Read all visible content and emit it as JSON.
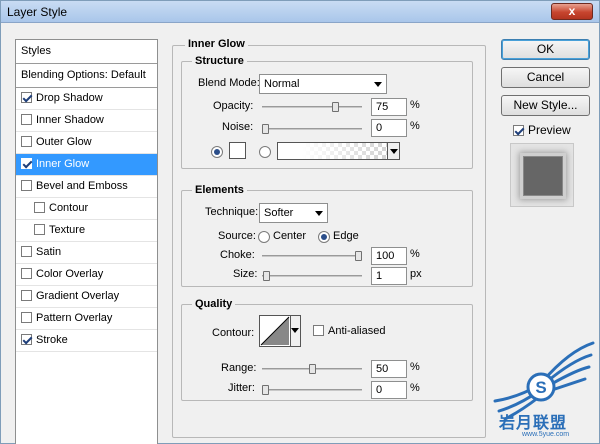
{
  "window": {
    "title": "Layer Style",
    "close_glyph": "x"
  },
  "styles_list": {
    "header": "Styles",
    "blending": "Blending Options: Default",
    "items": [
      {
        "label": "Drop Shadow",
        "checked": true
      },
      {
        "label": "Inner Shadow",
        "checked": false
      },
      {
        "label": "Outer Glow",
        "checked": false
      },
      {
        "label": "Inner Glow",
        "checked": true,
        "selected": true
      },
      {
        "label": "Bevel and Emboss",
        "checked": false
      },
      {
        "label": "Contour",
        "checked": false,
        "sub": true
      },
      {
        "label": "Texture",
        "checked": false,
        "sub": true
      },
      {
        "label": "Satin",
        "checked": false
      },
      {
        "label": "Color Overlay",
        "checked": false
      },
      {
        "label": "Gradient Overlay",
        "checked": false
      },
      {
        "label": "Pattern Overlay",
        "checked": false
      },
      {
        "label": "Stroke",
        "checked": true
      }
    ]
  },
  "panel": {
    "title": "Inner Glow",
    "structure": {
      "legend": "Structure",
      "blend_mode_label": "Blend Mode:",
      "blend_mode_value": "Normal",
      "opacity_label": "Opacity:",
      "opacity_value": "75",
      "opacity_level": 75,
      "opacity_unit": "%",
      "noise_label": "Noise:",
      "noise_value": "0",
      "noise_level": 0,
      "noise_unit": "%",
      "color_selected": true,
      "swatch_color": "#ffffff"
    },
    "elements": {
      "legend": "Elements",
      "technique_label": "Technique:",
      "technique_value": "Softer",
      "source_label": "Source:",
      "source_center": "Center",
      "source_edge": "Edge",
      "source_selected": "Edge",
      "choke_label": "Choke:",
      "choke_value": "100",
      "choke_level": 100,
      "choke_unit": "%",
      "size_label": "Size:",
      "size_value": "1",
      "size_level": 1,
      "size_unit": "px"
    },
    "quality": {
      "legend": "Quality",
      "contour_label": "Contour:",
      "anti_aliased_label": "Anti-aliased",
      "anti_aliased": false,
      "range_label": "Range:",
      "range_value": "50",
      "range_level": 50,
      "range_unit": "%",
      "jitter_label": "Jitter:",
      "jitter_value": "0",
      "jitter_level": 0,
      "jitter_unit": "%"
    }
  },
  "buttons": {
    "ok": "OK",
    "cancel": "Cancel",
    "new_style": "New Style..."
  },
  "preview": {
    "label": "Preview",
    "checked": true
  },
  "watermark": {
    "text": "岩月联盟",
    "sub": "www.5yue.com",
    "letter": "S"
  },
  "colors": {
    "selection": "#3399ff",
    "accent": "#2b6fb8"
  }
}
